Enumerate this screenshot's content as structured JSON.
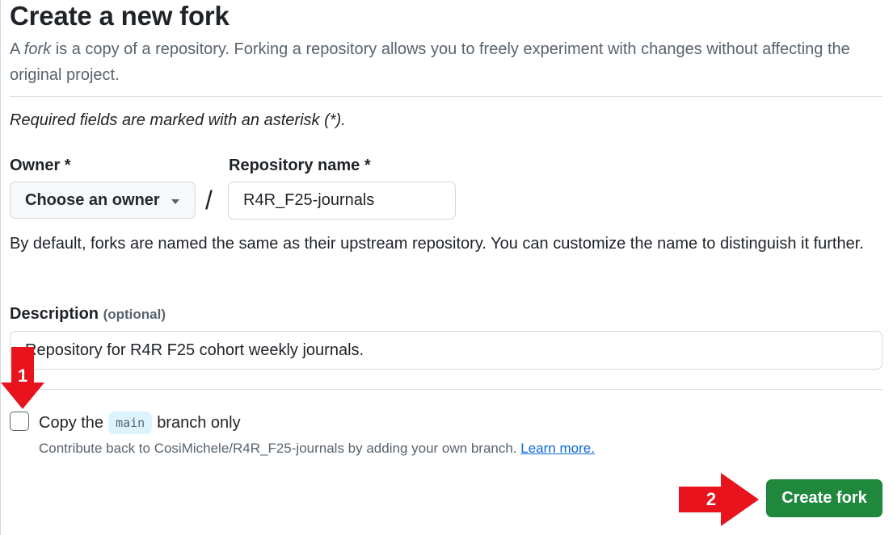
{
  "page": {
    "title": "Create a new fork",
    "subtitle_prefix": "A ",
    "subtitle_em": "fork",
    "subtitle_suffix": " is a copy of a repository. Forking a repository allows you to freely experiment with changes without affecting the original project.",
    "required_note": "Required fields are marked with an asterisk (*)."
  },
  "owner": {
    "label": "Owner *",
    "selected": "Choose an owner",
    "caret_icon": "triangle-down-icon"
  },
  "separator": "/",
  "repository": {
    "label": "Repository name *",
    "value": "R4R_F25-journals",
    "helper": "By default, forks are named the same as their upstream repository. You can customize the name to distinguish it further."
  },
  "description": {
    "label": "Description",
    "optional": "(optional)",
    "value": "Repository for R4R F25 cohort weekly journals."
  },
  "copy_branch": {
    "checked": false,
    "label_prefix": "Copy the",
    "branch": "main",
    "label_suffix": "branch only",
    "help_text": "Contribute back to CosiMichele/R4R_F25-journals by adding your own branch.",
    "learn_more": "Learn more."
  },
  "actions": {
    "create_label": "Create fork"
  },
  "annotations": [
    {
      "number": "1",
      "icon": "red-arrow-down-icon",
      "color": "#e8131c"
    },
    {
      "number": "2",
      "icon": "red-arrow-right-icon",
      "color": "#e8131c"
    }
  ],
  "colors": {
    "primary_button": "#1f883d",
    "link": "#0969da",
    "annotation": "#e8131c"
  }
}
